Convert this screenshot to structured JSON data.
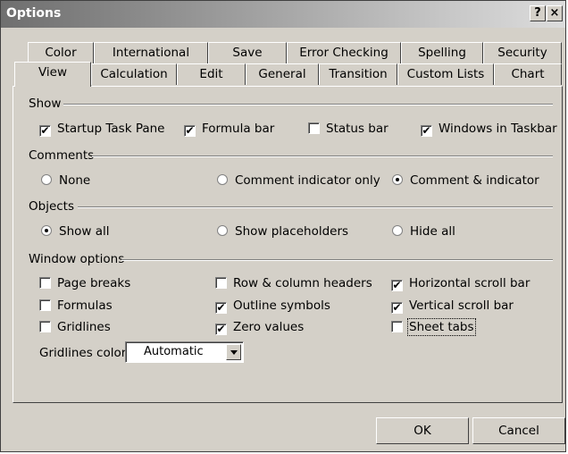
{
  "window": {
    "title": "Options",
    "help_label": "?",
    "close_label": "×"
  },
  "tabs_row1": [
    "Color",
    "International",
    "Save",
    "Error Checking",
    "Spelling",
    "Security"
  ],
  "tabs_row2": [
    "View",
    "Calculation",
    "Edit",
    "General",
    "Transition",
    "Custom Lists",
    "Chart"
  ],
  "active_tab": "View",
  "sections": {
    "show": "Show",
    "comments": "Comments",
    "objects": "Objects",
    "window_options": "Window options"
  },
  "show": {
    "startup_task_pane": {
      "label": "Startup Task Pane",
      "checked": true
    },
    "formula_bar": {
      "label": "Formula bar",
      "checked": true
    },
    "status_bar": {
      "label": "Status bar",
      "checked": false
    },
    "windows_in_taskbar": {
      "label": "Windows in Taskbar",
      "checked": true
    }
  },
  "comments": {
    "none": {
      "label": "None",
      "selected": false
    },
    "indicator_only": {
      "label": "Comment indicator only",
      "selected": false
    },
    "comment_and_indicator": {
      "label": "Comment & indicator",
      "selected": true
    }
  },
  "objects": {
    "show_all": {
      "label": "Show all",
      "selected": true
    },
    "show_placeholders": {
      "label": "Show placeholders",
      "selected": false
    },
    "hide_all": {
      "label": "Hide all",
      "selected": false
    }
  },
  "window_options": {
    "page_breaks": {
      "label": "Page breaks",
      "checked": false
    },
    "formulas": {
      "label": "Formulas",
      "checked": false
    },
    "gridlines": {
      "label": "Gridlines",
      "checked": false
    },
    "row_col_headers": {
      "label": "Row & column headers",
      "checked": false
    },
    "outline_symbols": {
      "label": "Outline symbols",
      "checked": true
    },
    "zero_values": {
      "label": "Zero values",
      "checked": true
    },
    "horizontal_scroll": {
      "label": "Horizontal scroll bar",
      "checked": true
    },
    "vertical_scroll": {
      "label": "Vertical scroll bar",
      "checked": true
    },
    "sheet_tabs": {
      "label": "Sheet tabs",
      "checked": false
    }
  },
  "gridlines_color": {
    "label": "Gridlines color:",
    "value": "Automatic"
  },
  "buttons": {
    "ok": "OK",
    "cancel": "Cancel"
  }
}
